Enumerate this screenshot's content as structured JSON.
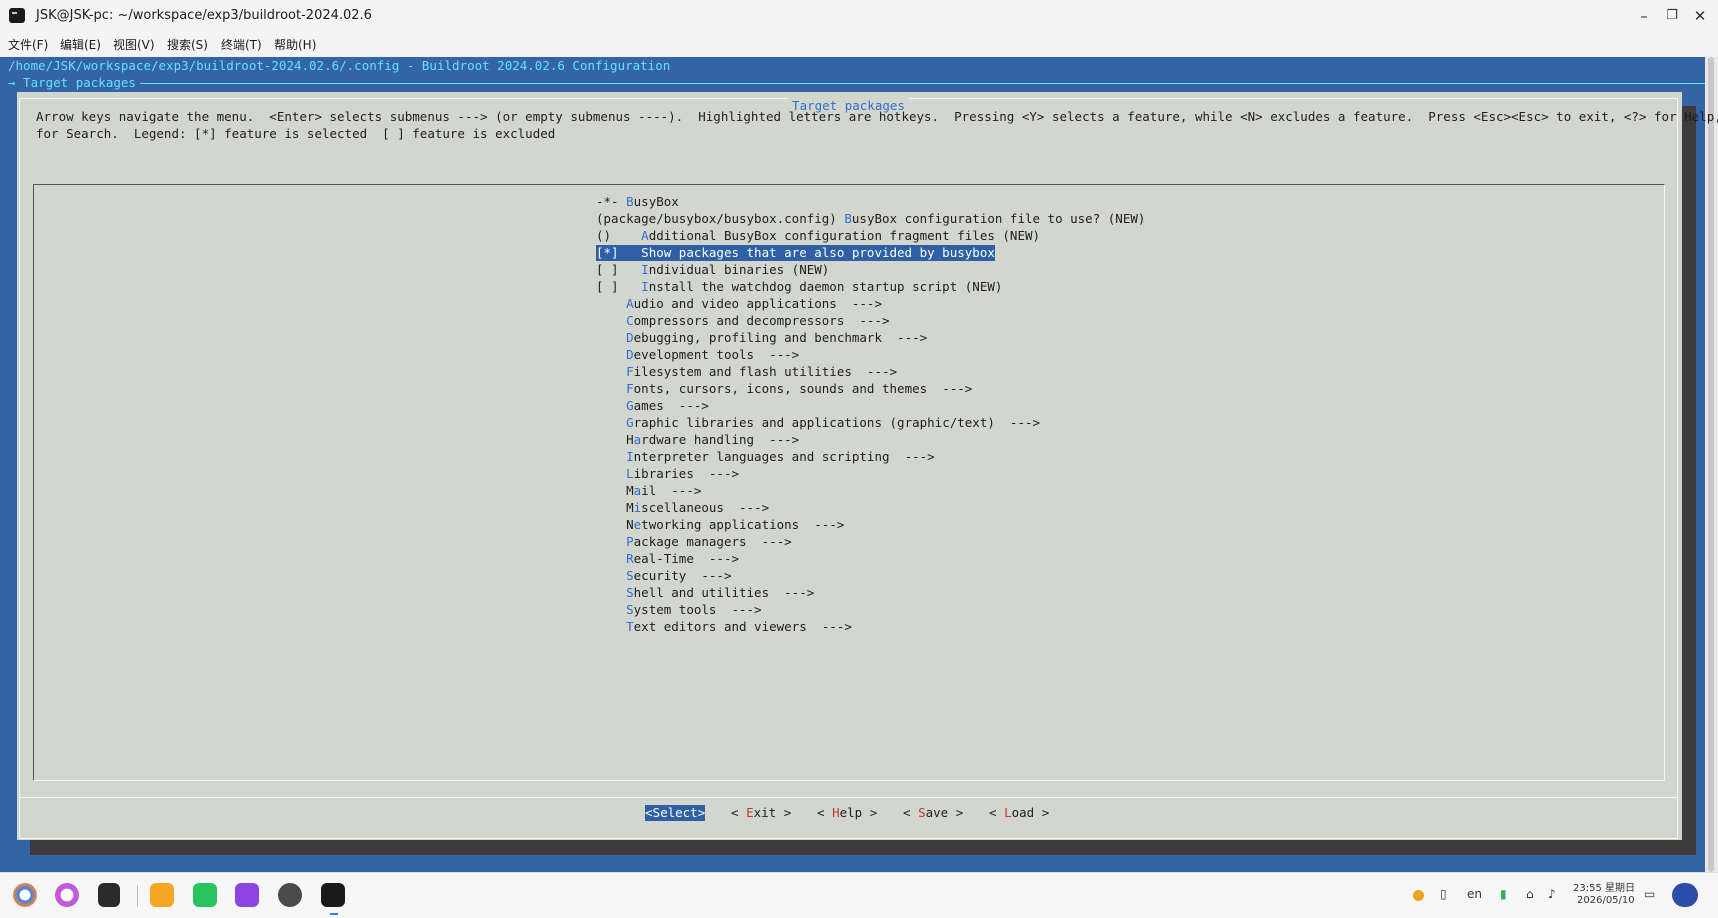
{
  "window": {
    "title": "JSK@JSK-pc: ~/workspace/exp3/buildroot-2024.02.6",
    "minimize": "–",
    "restore": "❐",
    "close": "✕"
  },
  "menubar": [
    "文件(F)",
    "编辑(E)",
    "视图(V)",
    "搜索(S)",
    "终端(T)",
    "帮助(H)"
  ],
  "terminal": {
    "path_line": "/home/JSK/workspace/exp3/buildroot-2024.02.6/.config - Buildroot 2024.02.6 Configuration",
    "breadcrumb": "→ Target packages",
    "dialog_title": "Target packages",
    "help_line1": "Arrow keys navigate the menu.  <Enter> selects submenus ---> (or empty submenus ----).  Highlighted letters are hotkeys.  Pressing <Y> selects a feature, while <N> excludes a feature.  Press <Esc><Esc> to exit, <?> for Help, </>",
    "help_line2": "for Search.  Legend: [*] feature is selected  [ ] feature is excluded",
    "items": [
      {
        "prefix": "-*- ",
        "hotkey": "B",
        "rest": "usyBox"
      },
      {
        "prefix": "(package/busybox/busybox.config) ",
        "hotkey": "B",
        "rest": "usyBox configuration file to use? (NEW)"
      },
      {
        "prefix": "()    ",
        "hotkey": "A",
        "rest": "dditional BusyBox configuration fragment files (NEW)"
      },
      {
        "prefix": "[*]   ",
        "hotkey": "S",
        "rest": "how packages that are also provided by busybox"
      },
      {
        "prefix": "[ ]   ",
        "hotkey": "I",
        "rest": "ndividual binaries (NEW)"
      },
      {
        "prefix": "[ ]   ",
        "hotkey": "I",
        "rest": "nstall the watchdog daemon startup script (NEW)"
      },
      {
        "prefix": "    ",
        "hotkey": "A",
        "rest": "udio and video applications  --->"
      },
      {
        "prefix": "    ",
        "hotkey": "C",
        "rest": "ompressors and decompressors  --->"
      },
      {
        "prefix": "    ",
        "hotkey": "D",
        "rest": "ebugging, profiling and benchmark  --->"
      },
      {
        "prefix": "    ",
        "hotkey": "D",
        "rest": "evelopment tools  --->"
      },
      {
        "prefix": "    ",
        "hotkey": "F",
        "rest": "ilesystem and flash utilities  --->"
      },
      {
        "prefix": "    ",
        "hotkey": "F",
        "rest": "onts, cursors, icons, sounds and themes  --->"
      },
      {
        "prefix": "    ",
        "hotkey": "G",
        "rest": "ames  --->"
      },
      {
        "prefix": "    ",
        "hotkey": "G",
        "rest": "raphic libraries and applications (graphic/text)  --->"
      },
      {
        "prefix": "    H",
        "hotkey": "a",
        "rest": "rdware handling  --->"
      },
      {
        "prefix": "    ",
        "hotkey": "I",
        "rest": "nterpreter languages and scripting  --->"
      },
      {
        "prefix": "    ",
        "hotkey": "L",
        "rest": "ibraries  --->"
      },
      {
        "prefix": "    M",
        "hotkey": "a",
        "rest": "il  --->"
      },
      {
        "prefix": "    M",
        "hotkey": "i",
        "rest": "scellaneous  --->"
      },
      {
        "prefix": "    N",
        "hotkey": "e",
        "rest": "tworking applications  --->"
      },
      {
        "prefix": "    ",
        "hotkey": "P",
        "rest": "ackage managers  --->"
      },
      {
        "prefix": "    ",
        "hotkey": "R",
        "rest": "eal-Time  --->"
      },
      {
        "prefix": "    ",
        "hotkey": "S",
        "rest": "ecurity  --->"
      },
      {
        "prefix": "    ",
        "hotkey": "S",
        "rest": "hell and utilities  --->"
      },
      {
        "prefix": "    ",
        "hotkey": "S",
        "rest": "ystem tools  --->"
      },
      {
        "prefix": "    ",
        "hotkey": "T",
        "rest": "ext editors and viewers  --->"
      }
    ],
    "buttons": [
      {
        "pre": "<",
        "hotkey": "S",
        "post": "elect>"
      },
      {
        "pre": "< ",
        "hotkey": "E",
        "post": "xit >"
      },
      {
        "pre": "< ",
        "hotkey": "H",
        "post": "elp >"
      },
      {
        "pre": "< ",
        "hotkey": "S",
        "post": "ave >"
      },
      {
        "pre": "< ",
        "hotkey": "L",
        "post": "oad >"
      }
    ]
  },
  "taskbar": {
    "lang": "en",
    "time": "23:55 星期日",
    "date": "2026/05/10",
    "icons": [
      "launcher-icon",
      "search-icon",
      "multitask-icon",
      "file-manager-icon",
      "wechat-icon",
      "camera-icon",
      "settings-icon",
      "terminal-icon"
    ],
    "colors": {
      "accent": "#2f5fa5",
      "terminal_bg": "#3264a6",
      "dialog_bg": "#d3d6cf",
      "hotkey_menu": "#2f6fcf",
      "hotkey_button": "#c0392b"
    }
  }
}
